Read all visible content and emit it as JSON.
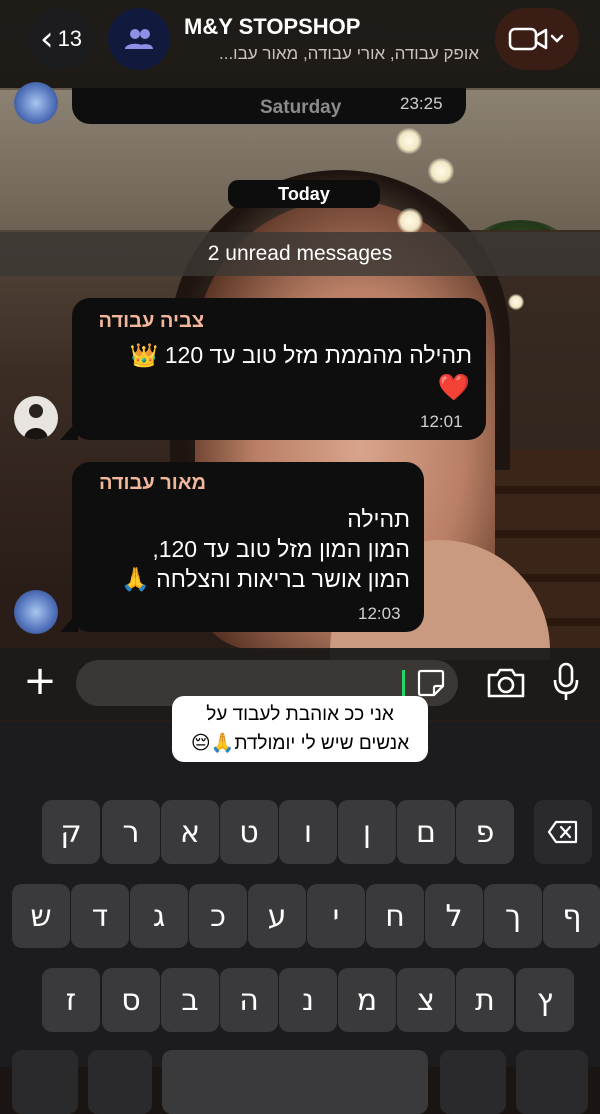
{
  "header": {
    "back_count": "13",
    "title": "M&Y STOPSHOP",
    "members": "אופק עבודה, אורי עבודה, מאור עבו..."
  },
  "chat": {
    "prev_day_label": "Saturday",
    "prev_time": "23:25",
    "today_label": "Today",
    "unread_label": "2 unread messages",
    "messages": [
      {
        "sender": "צביה עבודה",
        "line1": "תהילה מהממת מזל טוב עד 120 👑",
        "line2": "❤️",
        "time": "12:01"
      },
      {
        "sender": "מאור עבודה",
        "line1": "תהילה",
        "line2": "המון המון מזל טוב עד 120,",
        "line3": "המון אושר בריאות והצלחה 🙏",
        "time": "12:03"
      }
    ]
  },
  "suggestion": {
    "line1": "אני ככ אוהבת לעבוד על",
    "line2": "אנשים שיש לי יומולדת🙏😔"
  },
  "keyboard": {
    "row1": [
      "ק",
      "ר",
      "א",
      "ט",
      "ו",
      "ן",
      "ם",
      "פ"
    ],
    "row2": [
      "ש",
      "ד",
      "ג",
      "כ",
      "ע",
      "י",
      "ח",
      "ל",
      "ך",
      "ף"
    ],
    "row3": [
      "ז",
      "ס",
      "ב",
      "ה",
      "נ",
      "מ",
      "צ",
      "ת",
      "ץ"
    ]
  }
}
